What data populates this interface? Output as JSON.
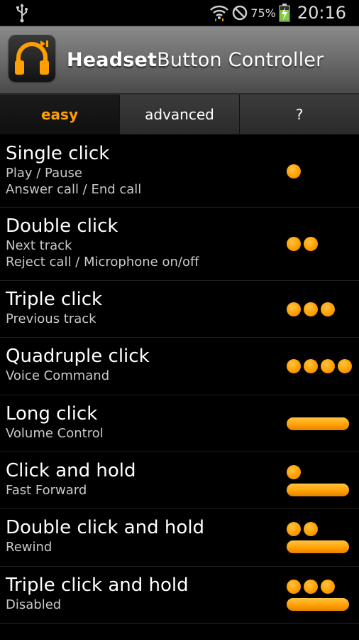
{
  "status_bar": {
    "battery_percent": "75%",
    "time": "20:16",
    "icons": [
      "usb-icon",
      "wifi-icon",
      "no-sim-icon",
      "battery-charging-icon"
    ]
  },
  "app": {
    "title_bold": "Headset",
    "title_rest": "Button Controller",
    "icon": "headphones-icon"
  },
  "tabs": [
    {
      "label": "easy",
      "active": true
    },
    {
      "label": "advanced",
      "active": false
    },
    {
      "label": "?",
      "active": false
    }
  ],
  "colors": {
    "accent": "#ff9f00",
    "background": "#000000",
    "secondary_text": "#c9c9c9"
  },
  "items": [
    {
      "title": "Single click",
      "desc1": "Play / Pause",
      "desc2": "Answer call / End call",
      "dots": 1,
      "bar": false
    },
    {
      "title": "Double click",
      "desc1": "Next track",
      "desc2": "Reject call / Microphone on/off",
      "dots": 2,
      "bar": false
    },
    {
      "title": "Triple click",
      "desc1": "Previous track",
      "desc2": "",
      "dots": 3,
      "bar": false
    },
    {
      "title": "Quadruple click",
      "desc1": "Voice Command",
      "desc2": "",
      "dots": 4,
      "bar": false
    },
    {
      "title": "Long click",
      "desc1": "Volume Control",
      "desc2": "",
      "dots": 0,
      "bar": true
    },
    {
      "title": "Click and hold",
      "desc1": "Fast Forward",
      "desc2": "",
      "dots": 1,
      "bar": true
    },
    {
      "title": "Double click and hold",
      "desc1": "Rewind",
      "desc2": "",
      "dots": 2,
      "bar": true
    },
    {
      "title": "Triple click and hold",
      "desc1": "Disabled",
      "desc2": "",
      "dots": 3,
      "bar": true
    }
  ]
}
